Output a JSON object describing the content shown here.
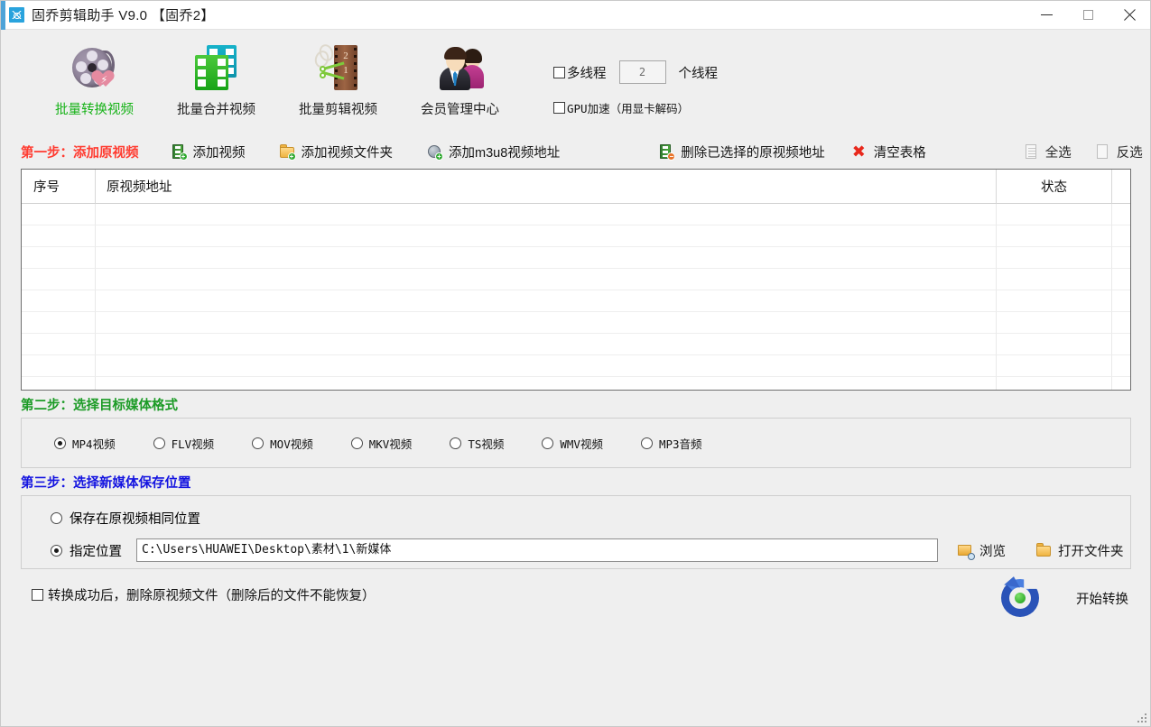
{
  "window": {
    "title": "固乔剪辑助手 V9.0  【固乔2】",
    "app_icon": "scissors-app-icon",
    "controls": {
      "minimize": "minimize-icon",
      "maximize": "maximize-icon",
      "close": "close-icon"
    }
  },
  "toolbar": {
    "items": [
      {
        "label": "批量转换视频",
        "icon": "film-reel-convert-icon",
        "active": true
      },
      {
        "label": "批量合并视频",
        "icon": "film-strips-merge-icon",
        "active": false
      },
      {
        "label": "批量剪辑视频",
        "icon": "scissors-film-cut-icon",
        "active": false
      },
      {
        "label": "会员管理中心",
        "icon": "two-users-icon",
        "active": false
      }
    ],
    "multithread": {
      "checkbox_label": "多线程",
      "checked": false,
      "value": "2",
      "unit_label": "个线程"
    },
    "gpu": {
      "checkbox_label": "GPU加速（用显卡解码）",
      "checked": false
    }
  },
  "step1": {
    "title": "第一步：添加原视频",
    "actions": [
      {
        "label": "添加视频",
        "icon": "film-add-icon"
      },
      {
        "label": "添加视频文件夹",
        "icon": "folder-add-icon"
      },
      {
        "label": "添加m3u8视频地址",
        "icon": "globe-add-icon"
      },
      {
        "label": "删除已选择的原视频地址",
        "icon": "film-remove-icon"
      },
      {
        "label": "清空表格",
        "icon": "red-cross-icon"
      },
      {
        "label": "全选",
        "icon": "select-all-icon"
      },
      {
        "label": "反选",
        "icon": "invert-selection-icon"
      }
    ]
  },
  "table": {
    "columns": [
      "序号",
      "原视频地址",
      "状态"
    ],
    "rows": [],
    "empty_row_count": 9
  },
  "step2": {
    "title": "第二步：选择目标媒体格式",
    "formats": [
      {
        "label": "MP4视频",
        "selected": true
      },
      {
        "label": "FLV视频",
        "selected": false
      },
      {
        "label": "MOV视频",
        "selected": false
      },
      {
        "label": "MKV视频",
        "selected": false
      },
      {
        "label": "TS视频",
        "selected": false
      },
      {
        "label": "WMV视频",
        "selected": false
      },
      {
        "label": "MP3音频",
        "selected": false
      }
    ]
  },
  "step3": {
    "title": "第三步：选择新媒体保存位置",
    "same_as_source": {
      "label": "保存在原视频相同位置",
      "selected": false
    },
    "custom": {
      "label": "指定位置",
      "selected": true
    },
    "path_value": "C:\\Users\\HUAWEI\\Desktop\\素材\\1\\新媒体",
    "browse_label": "浏览",
    "open_folder_label": "打开文件夹"
  },
  "footer": {
    "delete_after_label": "转换成功后，删除原视频文件（删除后的文件不能恢复）",
    "delete_after_checked": false,
    "start_label": "开始转换",
    "start_icon": "blue-refresh-start-icon"
  },
  "colors": {
    "step1_title": "#ff3b30",
    "step2_title": "#1c9b26",
    "step3_title": "#1414e0",
    "active_tool": "#16b217",
    "titlebar_accent": "#4da3d8"
  }
}
